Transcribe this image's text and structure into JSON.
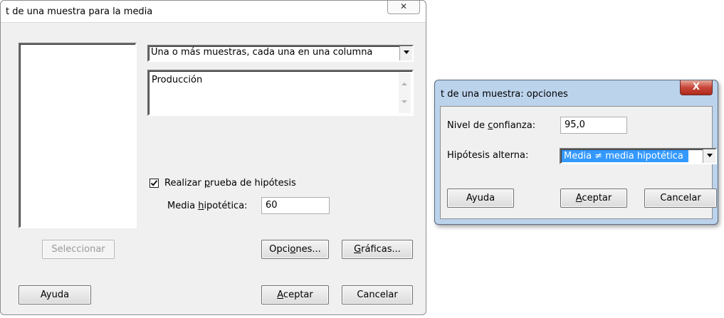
{
  "main_dialog": {
    "title": "t de una muestra para la media",
    "close_glyph": "✕",
    "data_mode_dropdown": {
      "selected": "Una o más muestras, cada una en una columna"
    },
    "columns_box": {
      "value": "Producción"
    },
    "hypothesis_checkbox": {
      "checked": true,
      "label_pre": "Realizar ",
      "label_ul": "p",
      "label_post": "rueba de hipótesis"
    },
    "hypothesized_mean": {
      "label_pre": "Media ",
      "label_ul": "h",
      "label_post": "ipotética:",
      "value": "60"
    },
    "buttons": {
      "select": "Seleccionar",
      "options_pre": "Opci",
      "options_ul": "o",
      "options_post": "nes...",
      "graphs_pre": "",
      "graphs_ul": "G",
      "graphs_post": "ráficas...",
      "help": "Ayuda",
      "ok_pre": "",
      "ok_ul": "A",
      "ok_post": "ceptar",
      "cancel": "Cancelar"
    }
  },
  "options_dialog": {
    "title": "t de una muestra: opciones",
    "close_glyph": "X",
    "confidence": {
      "label_pre": "Nivel de ",
      "label_ul": "c",
      "label_post": "onfianza:",
      "value": "95,0"
    },
    "alternative": {
      "label": "Hipótesis alterna:",
      "selected": "Media ≠ media hipotética"
    },
    "buttons": {
      "help": "Ayuda",
      "ok_pre": "",
      "ok_ul": "A",
      "ok_post": "ceptar",
      "cancel": "Cancelar"
    }
  },
  "colors": {
    "selection": "#3399ff",
    "dialog_bg": "#f0f0f0",
    "options_frame": "#bcd3ec",
    "close_red": "#c7463a"
  }
}
